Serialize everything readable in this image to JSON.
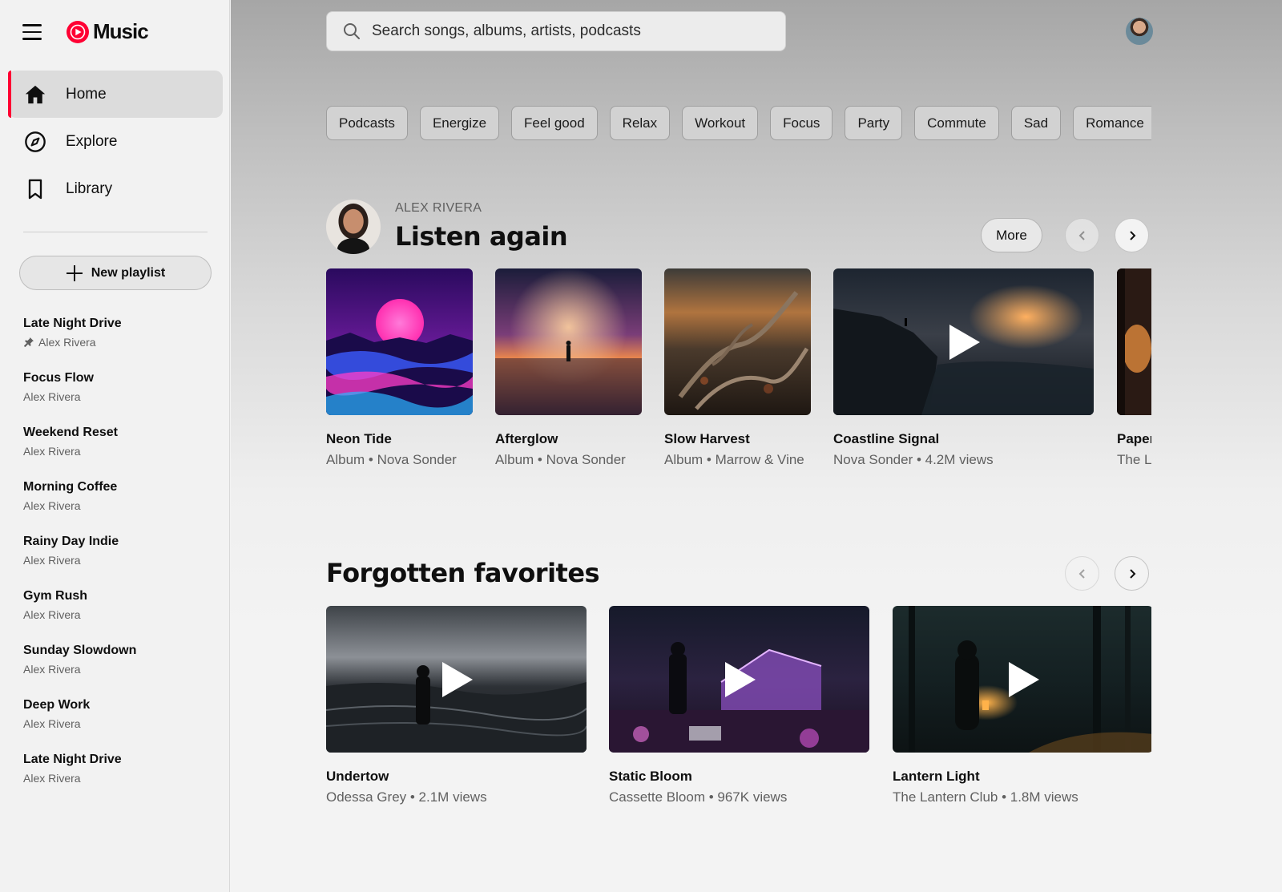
{
  "app": {
    "logo_text": "Music"
  },
  "sidebar": {
    "nav": [
      {
        "label": "Home",
        "icon": "home-icon",
        "active": true
      },
      {
        "label": "Explore",
        "icon": "compass-icon",
        "active": false
      },
      {
        "label": "Library",
        "icon": "bookmark-icon",
        "active": false
      }
    ],
    "new_playlist_label": "New playlist",
    "playlists": [
      {
        "title": "Late Night Drive",
        "owner": "Alex Rivera",
        "pinned": true
      },
      {
        "title": "Focus Flow",
        "owner": "Alex Rivera"
      },
      {
        "title": "Weekend Reset",
        "owner": "Alex Rivera"
      },
      {
        "title": "Morning Coffee",
        "owner": "Alex Rivera"
      },
      {
        "title": "Rainy Day Indie",
        "owner": "Alex Rivera"
      },
      {
        "title": "Gym Rush",
        "owner": "Alex Rivera"
      },
      {
        "title": "Sunday Slowdown",
        "owner": "Alex Rivera"
      },
      {
        "title": "Deep Work",
        "owner": "Alex Rivera"
      },
      {
        "title": "Late Night Drive",
        "owner": "Alex Rivera"
      }
    ]
  },
  "search": {
    "placeholder": "Search songs, albums, artists, podcasts"
  },
  "chips": [
    "Podcasts",
    "Energize",
    "Feel good",
    "Relax",
    "Workout",
    "Focus",
    "Party",
    "Commute",
    "Sad",
    "Romance",
    ""
  ],
  "listen_again": {
    "kicker": "ALEX RIVERA",
    "title": "Listen again",
    "more_label": "More",
    "cards": [
      {
        "title": "Neon Tide",
        "subtitle": "Album • Nova Sonder",
        "art": "neon"
      },
      {
        "title": "Afterglow",
        "subtitle": "Album • Nova Sonder",
        "art": "afterglow"
      },
      {
        "title": "Slow Harvest",
        "subtitle": "Album • Marrow & Vine",
        "art": "harvest"
      },
      {
        "title": "Coastline Signal",
        "subtitle": "Nova Sonder • 4.2M views",
        "art": "coast",
        "video": true
      },
      {
        "title": "Paper",
        "subtitle": "The L",
        "art": "lantern-partial"
      }
    ]
  },
  "forgotten": {
    "title": "Forgotten favorites",
    "cards": [
      {
        "title": "Undertow",
        "subtitle": "Odessa Grey • 2.1M views",
        "art": "undertow",
        "video": true
      },
      {
        "title": "Static Bloom",
        "subtitle": "Cassette Bloom • 967K views",
        "art": "bloom",
        "video": true
      },
      {
        "title": "Lantern Light",
        "subtitle": "The Lantern Club • 1.8M views",
        "art": "lantern",
        "video": true
      }
    ]
  },
  "colors": {
    "accent": "#ff0033",
    "text": "#0f0f0f",
    "secondary_text": "#606060"
  }
}
